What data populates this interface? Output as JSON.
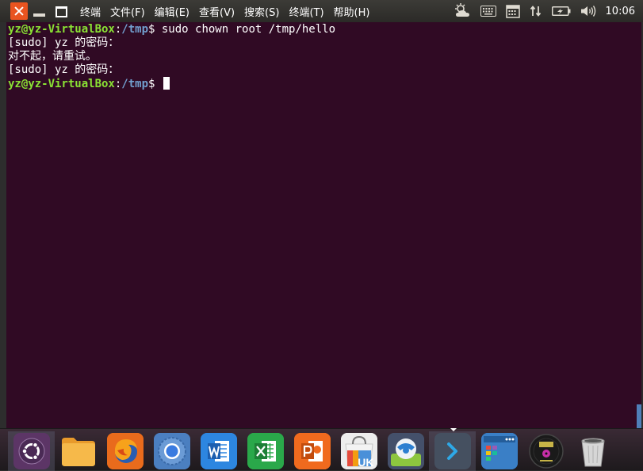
{
  "window": {
    "close_label": "close",
    "minimize_label": "minimize",
    "maximize_label": "maximize"
  },
  "menu": {
    "items": [
      {
        "label": "终端"
      },
      {
        "label": "文件(F)"
      },
      {
        "label": "编辑(E)"
      },
      {
        "label": "查看(V)"
      },
      {
        "label": "搜索(S)"
      },
      {
        "label": "终端(T)"
      },
      {
        "label": "帮助(H)"
      }
    ]
  },
  "indicators": {
    "clock": "10:06",
    "icons": [
      "weather-icon",
      "keyboard-icon",
      "calendar-icon",
      "network-icon",
      "battery-icon",
      "volume-icon"
    ]
  },
  "terminal": {
    "lines": [
      {
        "user": "yz@yz-VirtualBox",
        "sep": ":",
        "path": "/tmp",
        "rest": "$ sudo chown root /tmp/hello"
      },
      {
        "text": "[sudo] yz 的密码："
      },
      {
        "text": "对不起，请重试。"
      },
      {
        "text": "[sudo] yz 的密码："
      },
      {
        "user": "yz@yz-VirtualBox",
        "sep": ":",
        "path": "/tmp",
        "rest": "$ "
      }
    ]
  },
  "dock": {
    "items": [
      {
        "name": "ubuntu-dash-icon"
      },
      {
        "name": "files-icon"
      },
      {
        "name": "firefox-icon"
      },
      {
        "name": "chromium-icon"
      },
      {
        "name": "wps-writer-icon"
      },
      {
        "name": "wps-spreadsheets-icon"
      },
      {
        "name": "wps-presentation-icon"
      },
      {
        "name": "software-center-icon",
        "badge": "UK"
      },
      {
        "name": "remote-desktop-icon"
      },
      {
        "name": "terminal-icon"
      },
      {
        "name": "file-manager-icon"
      },
      {
        "name": "music-player-icon"
      },
      {
        "name": "trash-icon"
      }
    ]
  },
  "colors": {
    "terminal_bg": "#300a24",
    "prompt_user": "#8ae234",
    "prompt_path": "#729fcf",
    "close_button": "#e95420"
  }
}
